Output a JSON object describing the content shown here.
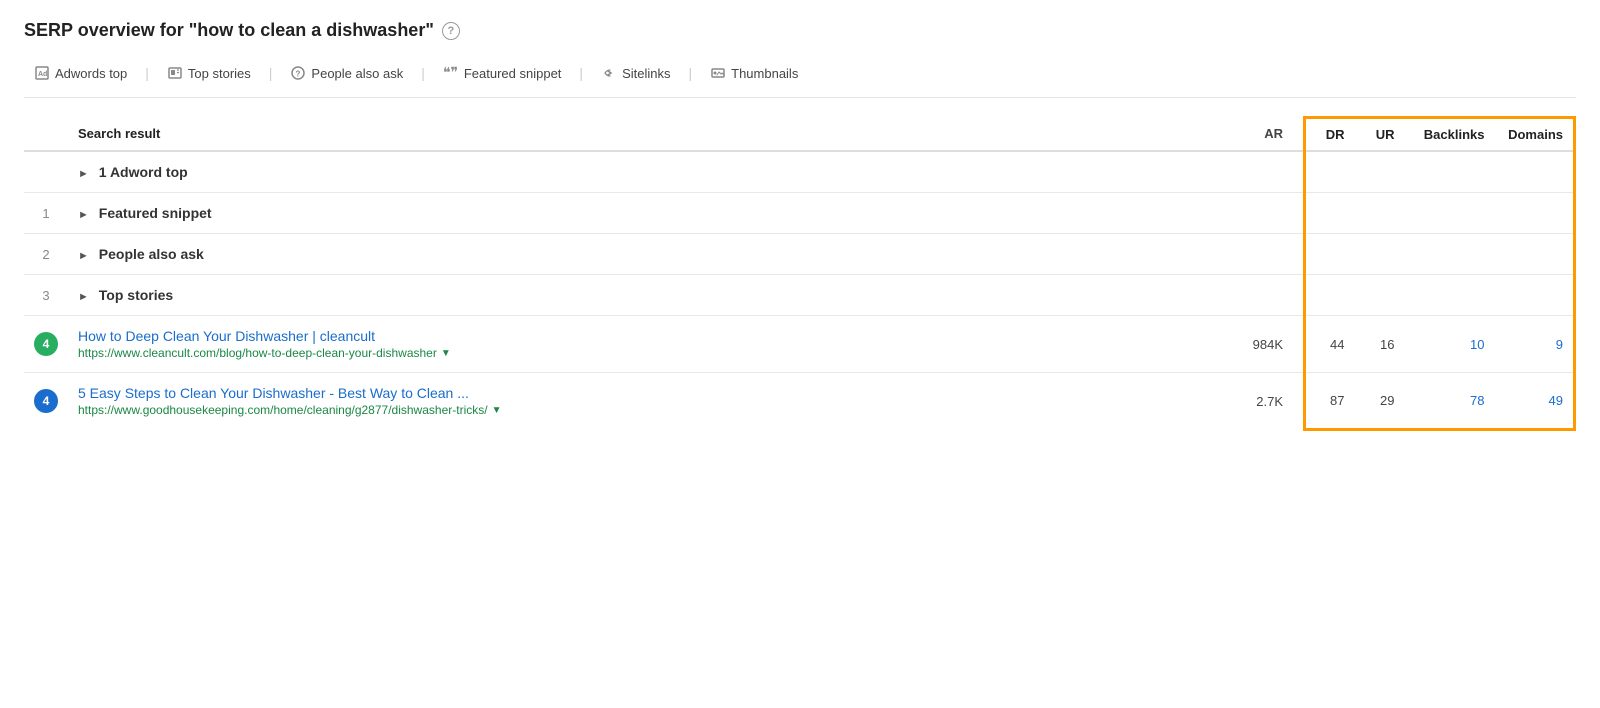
{
  "page": {
    "title": "SERP overview for \"how to clean a dishwasher\"",
    "help_icon": "?"
  },
  "filters": [
    {
      "id": "adwords-top",
      "icon": "ad",
      "label": "Adwords top"
    },
    {
      "id": "top-stories",
      "icon": "story",
      "label": "Top stories"
    },
    {
      "id": "people-also-ask",
      "icon": "q",
      "label": "People also ask"
    },
    {
      "id": "featured-snippet",
      "icon": "quote",
      "label": "Featured snippet"
    },
    {
      "id": "sitelinks",
      "icon": "link",
      "label": "Sitelinks"
    },
    {
      "id": "thumbnails",
      "icon": "image",
      "label": "Thumbnails"
    }
  ],
  "table": {
    "headers": {
      "result": "Search result",
      "ar": "AR",
      "dr": "DR",
      "ur": "UR",
      "backlinks": "Backlinks",
      "domains": "Domains"
    },
    "rows": [
      {
        "id": "adword-group",
        "rank": "",
        "type": "group",
        "label": "1 Adword top",
        "ar": "",
        "dr": "",
        "ur": "",
        "backlinks": "",
        "domains": "",
        "has_badge": false
      },
      {
        "id": "featured-snippet-group",
        "rank": "1",
        "type": "group",
        "label": "Featured snippet",
        "ar": "",
        "dr": "",
        "ur": "",
        "backlinks": "",
        "domains": "",
        "has_badge": false
      },
      {
        "id": "people-also-ask-group",
        "rank": "2",
        "type": "group",
        "label": "People also ask",
        "ar": "",
        "dr": "",
        "ur": "",
        "backlinks": "",
        "domains": "",
        "has_badge": false
      },
      {
        "id": "top-stories-group",
        "rank": "3",
        "type": "group",
        "label": "Top stories",
        "ar": "",
        "dr": "",
        "ur": "",
        "backlinks": "",
        "domains": "",
        "has_badge": false
      },
      {
        "id": "result-cleancult",
        "rank": "4",
        "type": "result",
        "badge_color": "green",
        "title": "How to Deep Clean Your Dishwasher | cleancult",
        "url": "https://www.cleancult.com/blog/how-to-deep-clean-your-dishwasher",
        "ar": "984K",
        "dr": "44",
        "ur": "16",
        "backlinks": "10",
        "domains": "9",
        "has_badge": true
      },
      {
        "id": "result-goodhousekeeping",
        "rank": "4",
        "type": "result",
        "badge_color": "blue",
        "title": "5 Easy Steps to Clean Your Dishwasher - Best Way to Clean ...",
        "url": "https://www.goodhousekeeping.com/home/cleaning/g2877/dishwasher-tricks/",
        "ar": "2.7K",
        "dr": "87",
        "ur": "29",
        "backlinks": "78",
        "domains": "49",
        "has_badge": true
      }
    ]
  }
}
